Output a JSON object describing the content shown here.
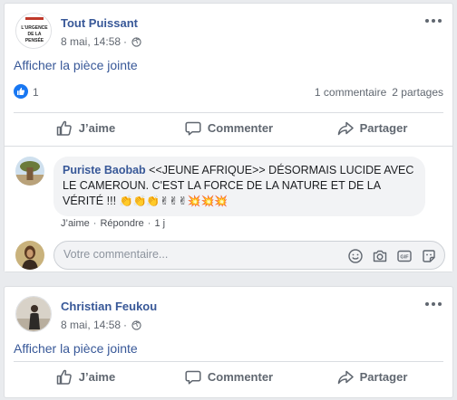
{
  "post1": {
    "author": "Tout Puissant",
    "timestamp": "8 mai, 14:58",
    "separator": "·",
    "attachment_link": "Afficher la pièce jointe",
    "avatar_text": [
      "L'URGENCE",
      "DE LA",
      "PENSÉE"
    ],
    "reaction_count": "1",
    "comments_count": "1 commentaire",
    "shares_count": "2 partages",
    "actions": {
      "like": "J’aime",
      "comment": "Commenter",
      "share": "Partager"
    },
    "comment": {
      "author": "Puriste Baobab",
      "text": "<<JEUNE AFRIQUE>> DÉSORMAIS LUCIDE AVEC LE CAMEROUN. C'EST LA FORCE DE LA NATURE ET DE LA VÉRITÉ !!!",
      "emojis": "👏👏👏✌✌✌💥💥💥",
      "like_label": "J’aime",
      "dot": "·",
      "reply_label": "Répondre",
      "age": "1 j"
    },
    "composer_placeholder": "Votre commentaire..."
  },
  "post2": {
    "author": "Christian Feukou",
    "timestamp": "8 mai, 14:58",
    "separator": "·",
    "attachment_link": "Afficher la pièce jointe",
    "actions": {
      "like": "J’aime",
      "comment": "Commenter",
      "share": "Partager"
    }
  },
  "colors": {
    "link": "#385898",
    "like_blue": "#1877f2",
    "muted": "#606770",
    "bubble": "#f2f3f5"
  }
}
